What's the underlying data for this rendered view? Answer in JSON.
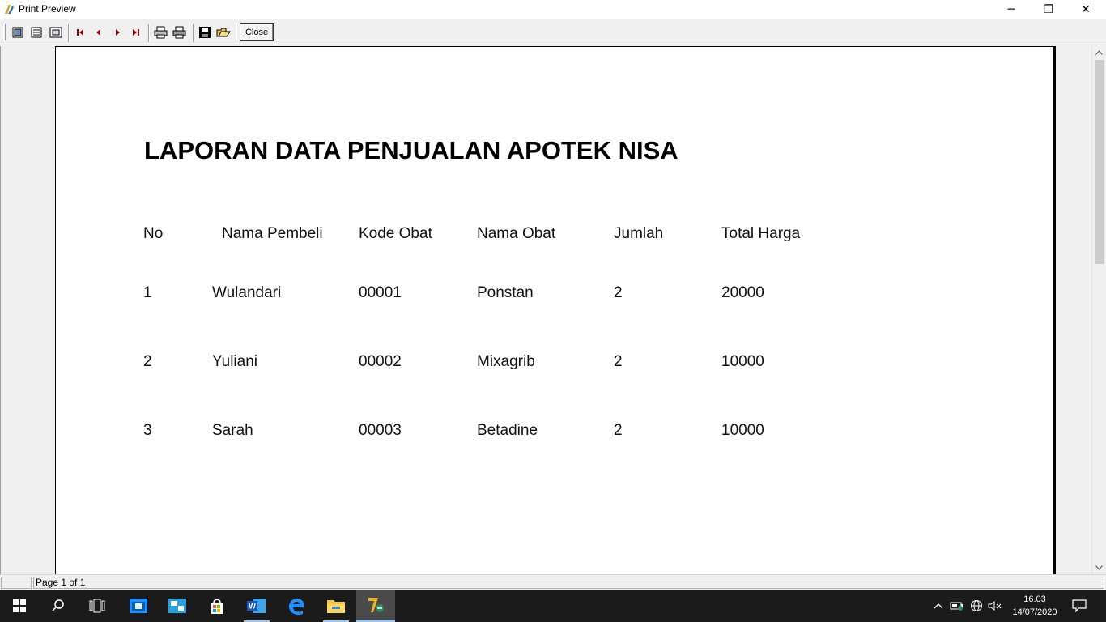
{
  "window": {
    "title": "Print Preview",
    "minimize_glyph": "─",
    "maximize_glyph": "❐",
    "close_glyph": "✕"
  },
  "toolbar": {
    "buttons": [
      "page-width-icon",
      "whole-page-icon",
      "zoom-icon",
      "first-page-icon",
      "previous-page-icon",
      "next-page-icon",
      "last-page-icon",
      "printer-setup-icon",
      "print-icon",
      "save-icon",
      "open-icon"
    ],
    "close_label": "Close"
  },
  "report": {
    "title": "LAPORAN DATA PENJUALAN APOTEK NISA",
    "headers": {
      "no": "No",
      "nama_pembeli": "Nama Pembeli",
      "kode_obat": "Kode Obat",
      "nama_obat": "Nama Obat",
      "jumlah": "Jumlah",
      "total_harga": "Total Harga"
    },
    "rows": [
      {
        "no": "1",
        "nama_pembeli": "Wulandari",
        "kode_obat": "00001",
        "nama_obat": "Ponstan",
        "jumlah": "2",
        "total_harga": "20000"
      },
      {
        "no": "2",
        "nama_pembeli": "Yuliani",
        "kode_obat": "00002",
        "nama_obat": "Mixagrib",
        "jumlah": "2",
        "total_harga": "10000"
      },
      {
        "no": "3",
        "nama_pembeli": "Sarah",
        "kode_obat": "00003",
        "nama_obat": "Betadine",
        "jumlah": "2",
        "total_harga": "10000"
      }
    ]
  },
  "statusbar": {
    "page_text": "Page 1 of 1"
  },
  "taskbar": {
    "items": [
      "start-icon",
      "search-icon",
      "task-view-icon",
      "app-icon",
      "app-icon",
      "store-icon",
      "word-icon",
      "edge-icon",
      "file-explorer-icon",
      "vb-app-icon"
    ],
    "time": "16.03",
    "date": "14/07/2020"
  },
  "colors": {
    "accent": "#9ec6ea",
    "taskbar": "#1b1b1b"
  }
}
